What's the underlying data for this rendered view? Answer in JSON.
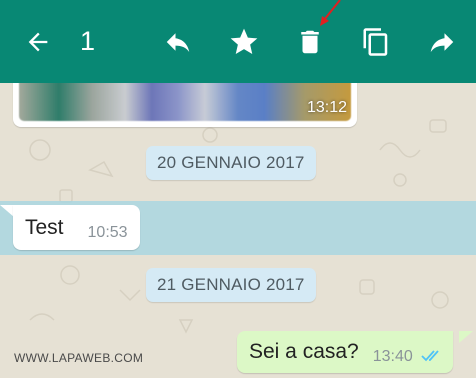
{
  "toolbar": {
    "selected_count": "1",
    "background_color": "#088874",
    "icons": [
      "back-arrow-icon",
      "reply-icon",
      "star-icon",
      "delete-icon",
      "copy-icon",
      "forward-icon"
    ]
  },
  "conversation": {
    "image_message": {
      "time": "13:12"
    },
    "date_separators": [
      "20 GENNAIO 2017",
      "21 GENNAIO 2017"
    ],
    "incoming_message": {
      "text": "Test",
      "time": "10:53",
      "selected": true
    },
    "outgoing_message": {
      "text": "Sei a casa?",
      "time": "13:40",
      "status": "read-double-check"
    }
  },
  "watermark": "WWW.LAPAWEB.COM",
  "colors": {
    "header": "#088874",
    "selection": "#a9d6e1",
    "outgoing_bubble": "#dcf8c6",
    "date_chip": "#d5eaf5",
    "read_ticks": "#4fc3f7",
    "annotation_arrow": "#e02020"
  }
}
